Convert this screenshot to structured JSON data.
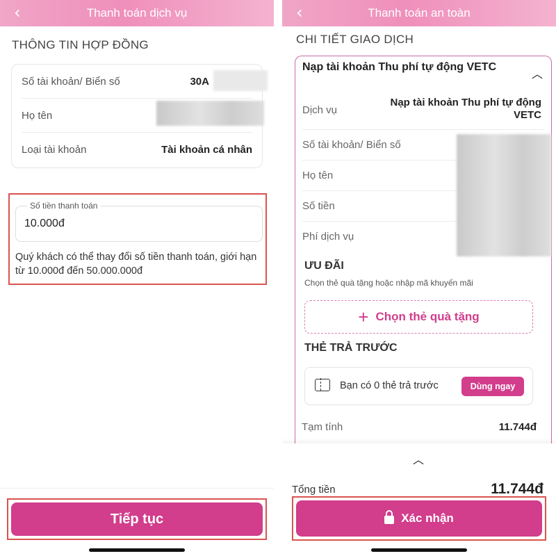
{
  "left": {
    "header": {
      "title": "Thanh toán dịch vụ",
      "back_icon": "‹"
    },
    "section_title": "THÔNG TIN HỢP ĐỒNG",
    "info": {
      "account_label": "Số tài khoản/ Biển số",
      "account_value": "30A",
      "name_label": "Họ tên",
      "type_label": "Loại tài khoản",
      "type_value": "Tài khoản cá nhân"
    },
    "amount": {
      "legend": "Số tiền thanh toán",
      "value": "10.000đ",
      "note": "Quý khách có thể thay đổi số tiền thanh toán, giới hạn từ 10.000đ đến 50.000.000đ"
    },
    "continue_label": "Tiếp tục"
  },
  "right": {
    "header": {
      "title": "Thanh toán an toàn",
      "back_icon": "‹"
    },
    "section_title": "CHI TIẾT GIAO DỊCH",
    "card_title": "Nạp tài khoản Thu phí tự động VETC",
    "rows": {
      "service_label": "Dịch vụ",
      "service_value": "Nạp tài khoản Thu phí tự động VETC",
      "account_label": "Số tài khoản/ Biển số",
      "name_label": "Họ tên",
      "amount_label": "Số tiền",
      "fee_label": "Phí dịch vụ"
    },
    "promo": {
      "title": "ƯU ĐÃI",
      "subtitle": "Chọn thẻ quà tặng hoặc nhập mã khuyến mãi",
      "gift_button": "Chọn thẻ quà tặng"
    },
    "prepaid": {
      "title": "THẺ TRẢ TRƯỚC",
      "text": "Bạn có 0 thẻ trả trước",
      "use_button": "Dùng ngay"
    },
    "subtotal_label": "Tạm tính",
    "subtotal_value": "11.744đ",
    "total_label": "Tổng tiền",
    "total_value": "11.744đ",
    "confirm_label": "Xác nhận"
  },
  "colors": {
    "accent": "#d23d8c",
    "highlight_box": "#d9534f",
    "header_gradient": "#ef8fbb"
  }
}
